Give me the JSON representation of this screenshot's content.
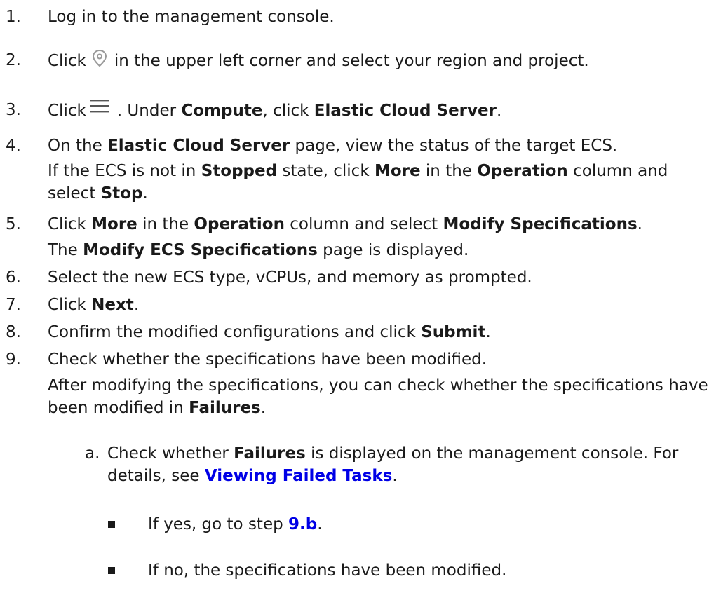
{
  "steps": [
    {
      "num": "1.",
      "text": "Log in to the management console."
    },
    {
      "num": "2.",
      "pre": "Click",
      "icon": "location-pin-icon",
      "post": "in the upper left corner and select your region and project."
    },
    {
      "num": "3.",
      "pre": "Click",
      "icon": "menu-icon",
      "a": ". Under ",
      "b": "Compute",
      "c": ", click ",
      "d": "Elastic Cloud Server",
      "e": "."
    },
    {
      "num": "4.",
      "a": "On the ",
      "b": "Elastic Cloud Server",
      "c": " page, view the status of the target ECS.",
      "detail": {
        "a": "If the ECS is not in ",
        "b": "Stopped",
        "c": " state, click ",
        "d": "More",
        "e": " in the ",
        "f": "Operation",
        "g": " column and select ",
        "h": "Stop",
        "i": "."
      }
    },
    {
      "num": "5.",
      "a": "Click ",
      "b": "More",
      "c": " in the ",
      "d": "Operation",
      "e": " column and select ",
      "f": "Modify Specifications",
      "g": ".",
      "detail": {
        "a": "The ",
        "b": "Modify ECS Specifications",
        "c": " page is displayed."
      }
    },
    {
      "num": "6.",
      "text": "Select the new ECS type, vCPUs, and memory as prompted."
    },
    {
      "num": "7.",
      "a": "Click ",
      "b": "Next",
      "c": "."
    },
    {
      "num": "8.",
      "a": "Confirm the modified configurations and click ",
      "b": "Submit",
      "c": "."
    },
    {
      "num": "9.",
      "text": "Check whether the specifications have been modified.",
      "detail": {
        "a": "After modifying the specifications, you can check whether the specifications have been modified in ",
        "b": "Failures",
        "c": "."
      },
      "sub": {
        "num": "a.",
        "a": "Check whether ",
        "b": "Failures",
        "c": " is displayed on the management console. For details, see ",
        "link": "Viewing Failed Tasks",
        "d": ".",
        "bullets": [
          {
            "a": "If yes, go to step ",
            "link": "9.b",
            "b": "."
          },
          {
            "text": "If no, the specifications have been modified."
          }
        ]
      }
    }
  ]
}
